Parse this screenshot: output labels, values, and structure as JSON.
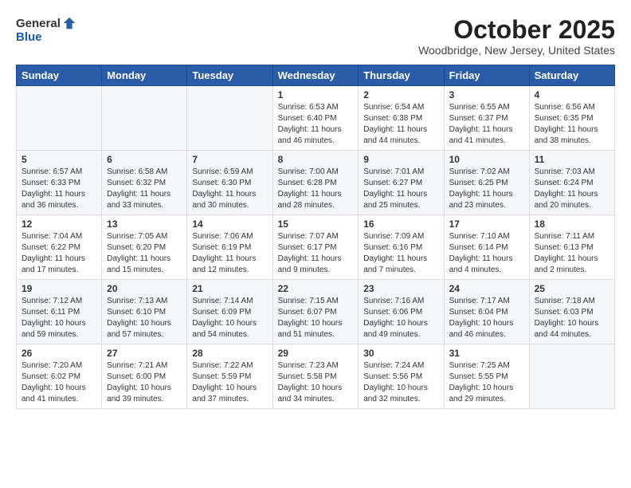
{
  "header": {
    "logo_general": "General",
    "logo_blue": "Blue",
    "month_title": "October 2025",
    "location": "Woodbridge, New Jersey, United States"
  },
  "days_of_week": [
    "Sunday",
    "Monday",
    "Tuesday",
    "Wednesday",
    "Thursday",
    "Friday",
    "Saturday"
  ],
  "weeks": [
    [
      {
        "day": "",
        "info": ""
      },
      {
        "day": "",
        "info": ""
      },
      {
        "day": "",
        "info": ""
      },
      {
        "day": "1",
        "info": "Sunrise: 6:53 AM\nSunset: 6:40 PM\nDaylight: 11 hours\nand 46 minutes."
      },
      {
        "day": "2",
        "info": "Sunrise: 6:54 AM\nSunset: 6:38 PM\nDaylight: 11 hours\nand 44 minutes."
      },
      {
        "day": "3",
        "info": "Sunrise: 6:55 AM\nSunset: 6:37 PM\nDaylight: 11 hours\nand 41 minutes."
      },
      {
        "day": "4",
        "info": "Sunrise: 6:56 AM\nSunset: 6:35 PM\nDaylight: 11 hours\nand 38 minutes."
      }
    ],
    [
      {
        "day": "5",
        "info": "Sunrise: 6:57 AM\nSunset: 6:33 PM\nDaylight: 11 hours\nand 36 minutes."
      },
      {
        "day": "6",
        "info": "Sunrise: 6:58 AM\nSunset: 6:32 PM\nDaylight: 11 hours\nand 33 minutes."
      },
      {
        "day": "7",
        "info": "Sunrise: 6:59 AM\nSunset: 6:30 PM\nDaylight: 11 hours\nand 30 minutes."
      },
      {
        "day": "8",
        "info": "Sunrise: 7:00 AM\nSunset: 6:28 PM\nDaylight: 11 hours\nand 28 minutes."
      },
      {
        "day": "9",
        "info": "Sunrise: 7:01 AM\nSunset: 6:27 PM\nDaylight: 11 hours\nand 25 minutes."
      },
      {
        "day": "10",
        "info": "Sunrise: 7:02 AM\nSunset: 6:25 PM\nDaylight: 11 hours\nand 23 minutes."
      },
      {
        "day": "11",
        "info": "Sunrise: 7:03 AM\nSunset: 6:24 PM\nDaylight: 11 hours\nand 20 minutes."
      }
    ],
    [
      {
        "day": "12",
        "info": "Sunrise: 7:04 AM\nSunset: 6:22 PM\nDaylight: 11 hours\nand 17 minutes."
      },
      {
        "day": "13",
        "info": "Sunrise: 7:05 AM\nSunset: 6:20 PM\nDaylight: 11 hours\nand 15 minutes."
      },
      {
        "day": "14",
        "info": "Sunrise: 7:06 AM\nSunset: 6:19 PM\nDaylight: 11 hours\nand 12 minutes."
      },
      {
        "day": "15",
        "info": "Sunrise: 7:07 AM\nSunset: 6:17 PM\nDaylight: 11 hours\nand 9 minutes."
      },
      {
        "day": "16",
        "info": "Sunrise: 7:09 AM\nSunset: 6:16 PM\nDaylight: 11 hours\nand 7 minutes."
      },
      {
        "day": "17",
        "info": "Sunrise: 7:10 AM\nSunset: 6:14 PM\nDaylight: 11 hours\nand 4 minutes."
      },
      {
        "day": "18",
        "info": "Sunrise: 7:11 AM\nSunset: 6:13 PM\nDaylight: 11 hours\nand 2 minutes."
      }
    ],
    [
      {
        "day": "19",
        "info": "Sunrise: 7:12 AM\nSunset: 6:11 PM\nDaylight: 10 hours\nand 59 minutes."
      },
      {
        "day": "20",
        "info": "Sunrise: 7:13 AM\nSunset: 6:10 PM\nDaylight: 10 hours\nand 57 minutes."
      },
      {
        "day": "21",
        "info": "Sunrise: 7:14 AM\nSunset: 6:09 PM\nDaylight: 10 hours\nand 54 minutes."
      },
      {
        "day": "22",
        "info": "Sunrise: 7:15 AM\nSunset: 6:07 PM\nDaylight: 10 hours\nand 51 minutes."
      },
      {
        "day": "23",
        "info": "Sunrise: 7:16 AM\nSunset: 6:06 PM\nDaylight: 10 hours\nand 49 minutes."
      },
      {
        "day": "24",
        "info": "Sunrise: 7:17 AM\nSunset: 6:04 PM\nDaylight: 10 hours\nand 46 minutes."
      },
      {
        "day": "25",
        "info": "Sunrise: 7:18 AM\nSunset: 6:03 PM\nDaylight: 10 hours\nand 44 minutes."
      }
    ],
    [
      {
        "day": "26",
        "info": "Sunrise: 7:20 AM\nSunset: 6:02 PM\nDaylight: 10 hours\nand 41 minutes."
      },
      {
        "day": "27",
        "info": "Sunrise: 7:21 AM\nSunset: 6:00 PM\nDaylight: 10 hours\nand 39 minutes."
      },
      {
        "day": "28",
        "info": "Sunrise: 7:22 AM\nSunset: 5:59 PM\nDaylight: 10 hours\nand 37 minutes."
      },
      {
        "day": "29",
        "info": "Sunrise: 7:23 AM\nSunset: 5:58 PM\nDaylight: 10 hours\nand 34 minutes."
      },
      {
        "day": "30",
        "info": "Sunrise: 7:24 AM\nSunset: 5:56 PM\nDaylight: 10 hours\nand 32 minutes."
      },
      {
        "day": "31",
        "info": "Sunrise: 7:25 AM\nSunset: 5:55 PM\nDaylight: 10 hours\nand 29 minutes."
      },
      {
        "day": "",
        "info": ""
      }
    ]
  ]
}
